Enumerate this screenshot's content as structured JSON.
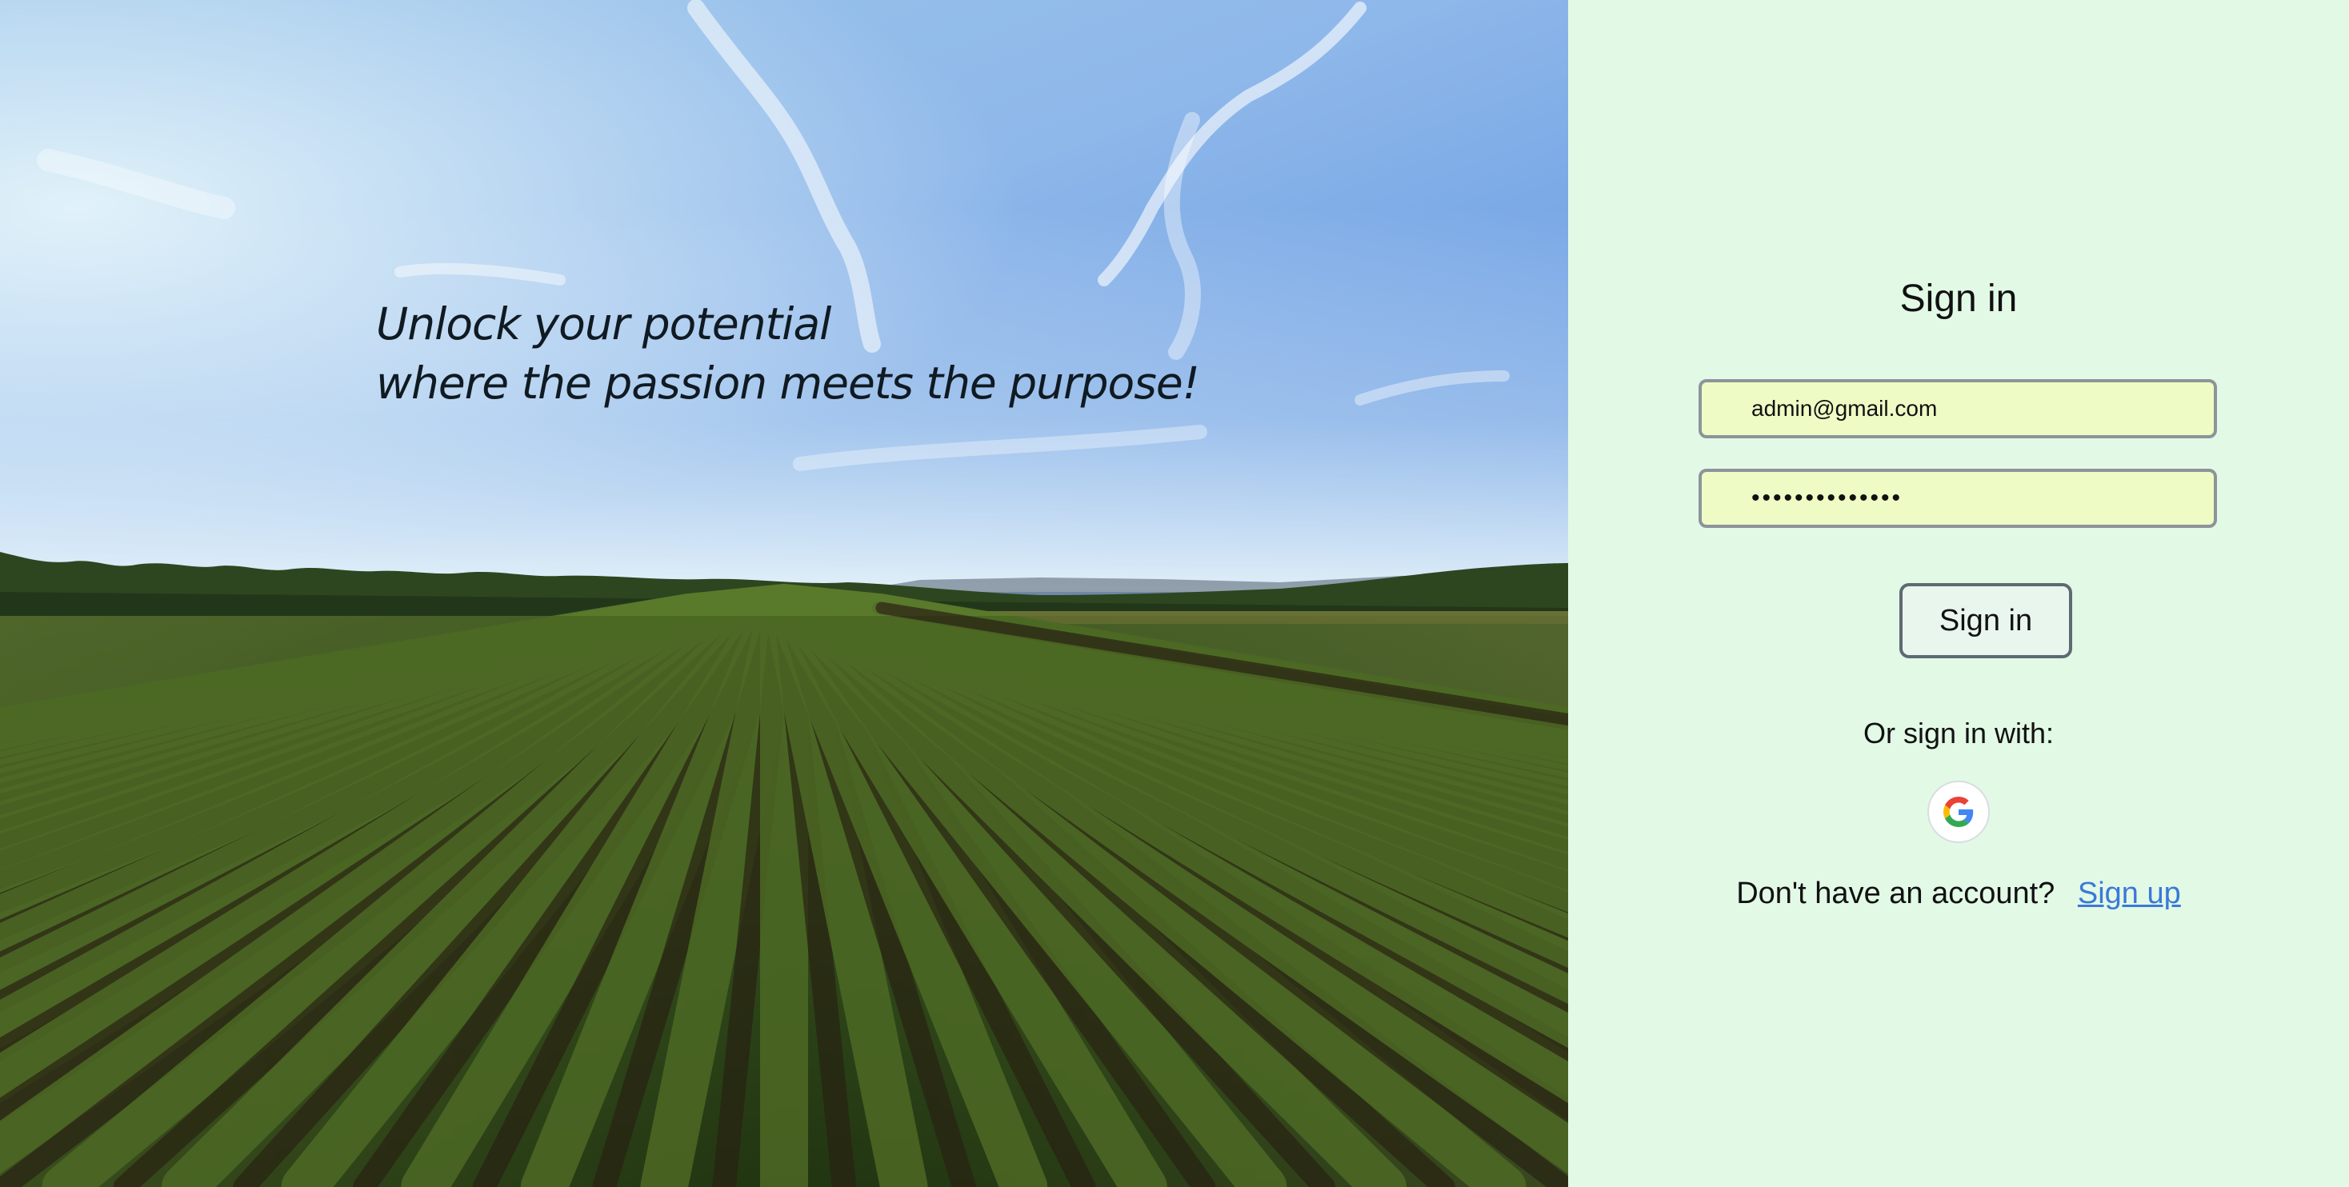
{
  "hero": {
    "tagline_line1": "Unlock your potential",
    "tagline_line2": "where the passion meets the purpose!"
  },
  "signin": {
    "title": "Sign in",
    "email_value": "admin@gmail.com",
    "password_value": "••••••••••••••",
    "submit_label": "Sign in",
    "alt_label": "Or sign in with:",
    "google_icon": "google-logo",
    "no_account_text": "Don't have an account?",
    "signup_label": "Sign up"
  },
  "colors": {
    "panel_bg": "#e2f9e6",
    "field_bg": "#eefbc4",
    "link": "#3b79d8"
  }
}
